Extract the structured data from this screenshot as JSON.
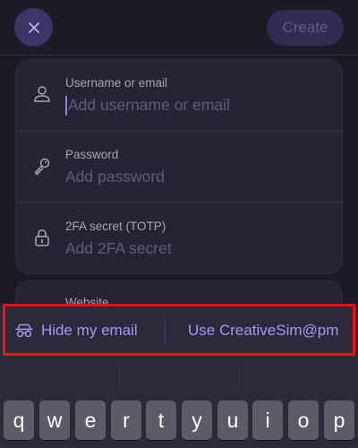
{
  "header": {
    "close_icon": "close-icon",
    "create_label": "Create"
  },
  "form": {
    "username": {
      "label": "Username or email",
      "placeholder": "Add username or email",
      "icon": "person-icon"
    },
    "password": {
      "label": "Password",
      "placeholder": "Add password",
      "icon": "key-icon"
    },
    "totp": {
      "label": "2FA secret (TOTP)",
      "placeholder": "Add 2FA secret",
      "icon": "lock-icon"
    },
    "website": {
      "label": "Website"
    }
  },
  "suggestions": {
    "hide_email_label": "Hide my email",
    "hide_email_icon": "incognito-icon",
    "use_email_label": "Use CreativeSim@pm"
  },
  "keyboard": {
    "keys": [
      "q",
      "w",
      "e",
      "r",
      "t",
      "y",
      "u",
      "i",
      "o",
      "p"
    ]
  },
  "colors": {
    "accent": "#a797f4",
    "highlight": "#ff0b0b"
  }
}
